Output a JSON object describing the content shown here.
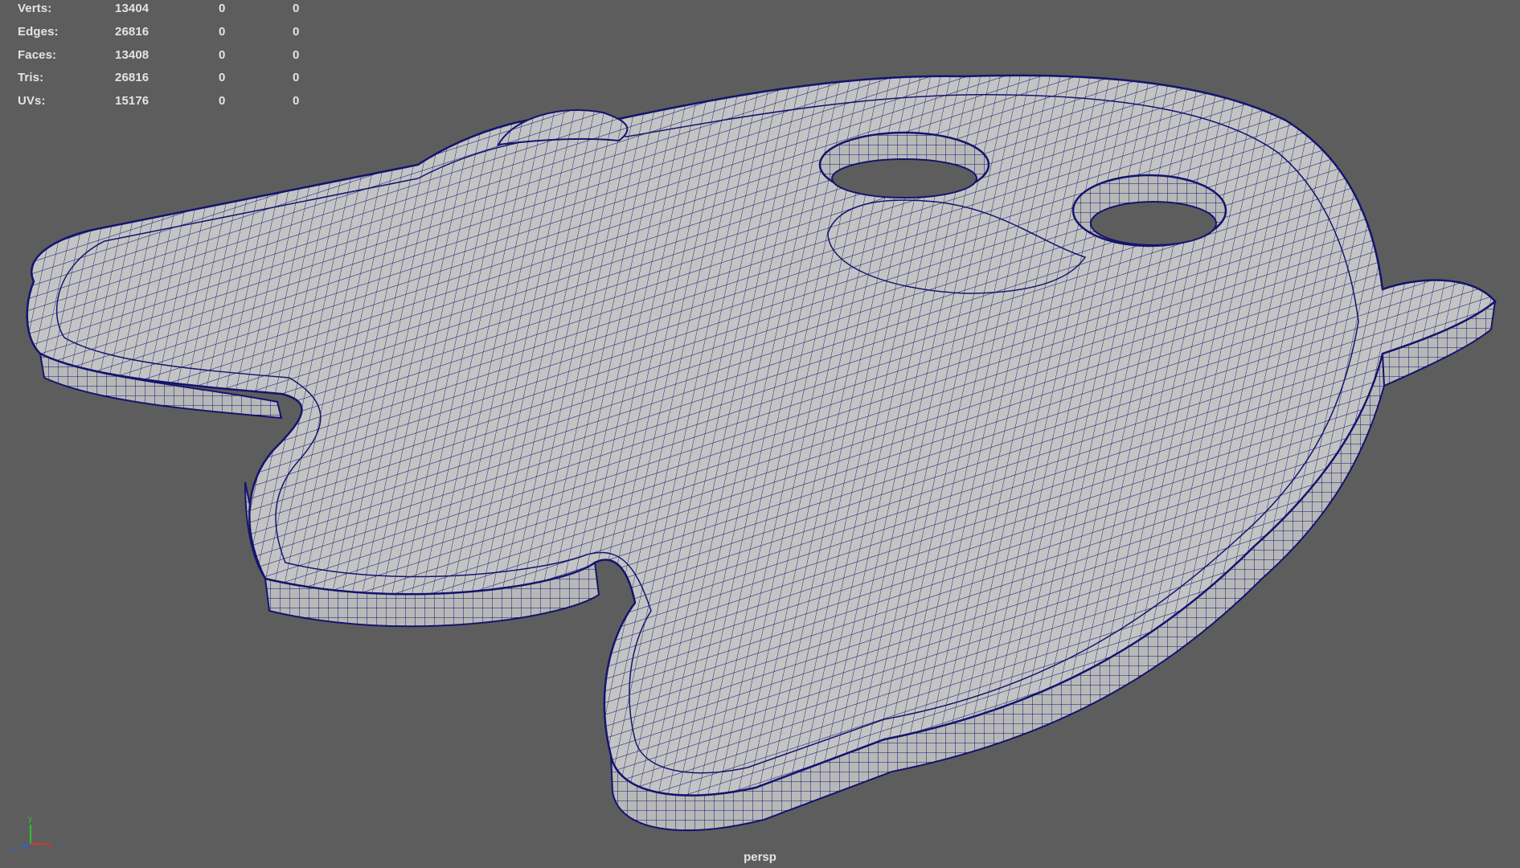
{
  "hud": {
    "rows": [
      {
        "label": "Verts:",
        "v1": "13404",
        "v2": "0",
        "v3": "0"
      },
      {
        "label": "Edges:",
        "v1": "26816",
        "v2": "0",
        "v3": "0"
      },
      {
        "label": "Faces:",
        "v1": "13408",
        "v2": "0",
        "v3": "0"
      },
      {
        "label": "Tris:",
        "v1": "26816",
        "v2": "0",
        "v3": "0"
      },
      {
        "label": "UVs:",
        "v1": "15176",
        "v2": "0",
        "v3": "0"
      }
    ]
  },
  "camera": {
    "name": "persp"
  },
  "gizmo": {
    "y": "y",
    "z": "z",
    "x": "x"
  },
  "colors": {
    "background": "#5d5d5d",
    "mesh_surface": "#c4c4c4",
    "wireframe": "#14146e",
    "hud_text": "#e4e4e4",
    "axis_x": "#e03030",
    "axis_y": "#30c030",
    "axis_z": "#3060e0"
  }
}
